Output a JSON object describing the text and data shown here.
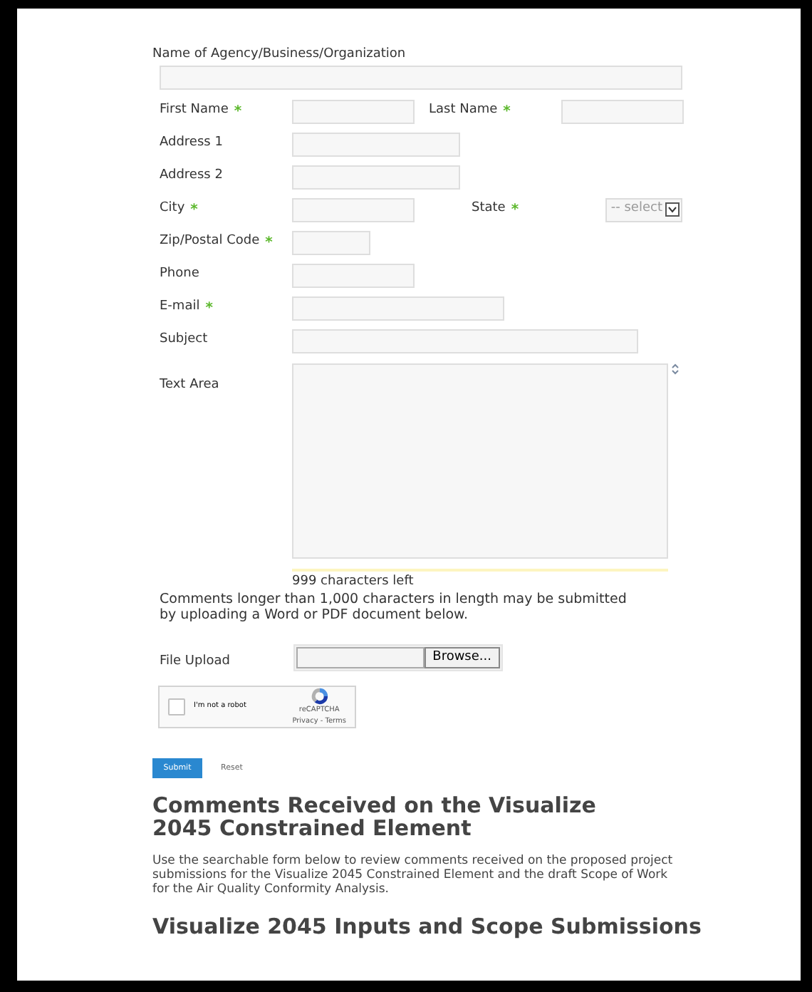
{
  "required_mark": "*",
  "organization": {
    "label": "Name of Agency/Business/Organization"
  },
  "rows": [
    {
      "fields": [
        {
          "label": "First Name",
          "required": true,
          "kind": "text"
        },
        {
          "label": "Last Name",
          "required": true,
          "kind": "text"
        }
      ]
    },
    {
      "fields": [
        {
          "label": "Address 1",
          "required": false,
          "kind": "text"
        }
      ]
    },
    {
      "fields": [
        {
          "label": "Address 2",
          "required": false,
          "kind": "text"
        }
      ]
    },
    {
      "fields": [
        {
          "label": "City",
          "required": true,
          "kind": "text"
        },
        {
          "label": "State",
          "required": true,
          "kind": "select",
          "value": "-- select"
        }
      ]
    },
    {
      "fields": [
        {
          "label": "Zip/Postal Code",
          "required": true,
          "kind": "text"
        }
      ]
    },
    {
      "fields": [
        {
          "label": "Phone",
          "required": false,
          "kind": "text"
        }
      ]
    },
    {
      "fields": [
        {
          "label": "E-mail",
          "required": true,
          "kind": "text"
        }
      ]
    },
    {
      "fields": [
        {
          "label": "Subject",
          "required": false,
          "kind": "text"
        }
      ]
    }
  ],
  "text_area": {
    "label": "Text Area",
    "counter": "999 characters left"
  },
  "note": "Comments longer than 1,000 characters in length may be submitted by uploading a Word or PDF document below.",
  "file_upload": {
    "label": "File Upload",
    "button": "Browse..."
  },
  "captcha": {
    "label": "I'm not a robot",
    "checked": false,
    "brand": "reCAPTCHA",
    "links": "Privacy - Terms"
  },
  "buttons": {
    "submit": "Submit",
    "reset": "Reset"
  },
  "heading": "Comments Received on the Visualize 2045 Constrained Element",
  "paragraph": "Use the searchable form below to review comments received on the proposed project submissions for the Visualize 2045 Constrained Element and the draft Scope of Work for the Air Quality Conformity Analysis.",
  "heading_2": "Visualize 2045 Inputs and Scope Submissions"
}
